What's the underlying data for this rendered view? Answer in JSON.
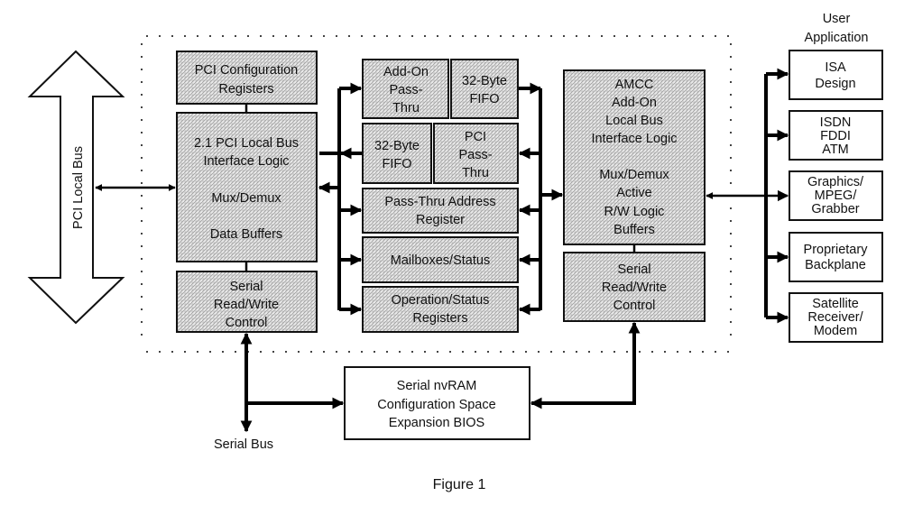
{
  "figure": {
    "caption": "Figure 1",
    "pci_local_bus_label": "PCI Local Bus",
    "serial_bus_label": "Serial Bus",
    "user_application_title": [
      "User",
      "Application"
    ]
  },
  "left_blocks": {
    "pci_config": [
      "PCI Configuration",
      "Registers"
    ],
    "pci_interface": [
      "2.1 PCI Local Bus",
      "Interface Logic",
      "",
      "Mux/Demux",
      "",
      "Data Buffers"
    ],
    "serial_rw_left": [
      "Serial",
      "Read/Write",
      "Control"
    ]
  },
  "middle_blocks": {
    "addon_passthru": [
      "Add-On",
      "Pass-",
      "Thru"
    ],
    "fifo_top": [
      "32-Byte",
      "FIFO"
    ],
    "fifo_mid": [
      "32-Byte",
      "FIFO"
    ],
    "pci_passthru": [
      "PCI",
      "Pass-",
      "Thru"
    ],
    "passthru_address": [
      "Pass-Thru Address",
      "Register"
    ],
    "mailboxes": [
      "Mailboxes/Status"
    ],
    "operation_status": [
      "Operation/Status",
      "Registers"
    ]
  },
  "right_blocks": {
    "amcc": [
      "AMCC",
      "Add-On",
      "Local Bus",
      "Interface Logic",
      "",
      "Mux/Demux",
      "Active",
      "R/W Logic",
      "Buffers"
    ],
    "serial_rw_right": [
      "Serial",
      "Read/Write",
      "Control"
    ]
  },
  "nvram": [
    "Serial nvRAM",
    "Configuration Space",
    "Expansion BIOS"
  ],
  "user_apps": [
    {
      "lines": [
        "ISA",
        "Design"
      ]
    },
    {
      "lines": [
        "ISDN",
        "FDDI",
        "ATM"
      ]
    },
    {
      "lines": [
        "Graphics/",
        "MPEG/",
        "Grabber"
      ]
    },
    {
      "lines": [
        "Proprietary",
        "Backplane"
      ]
    },
    {
      "lines": [
        "Satellite",
        "Receiver/",
        "Modem"
      ]
    }
  ],
  "colors": {
    "ink": "#111111",
    "hatch_bg": "#e6e6e6",
    "hatch_line": "#9a9a9a"
  }
}
